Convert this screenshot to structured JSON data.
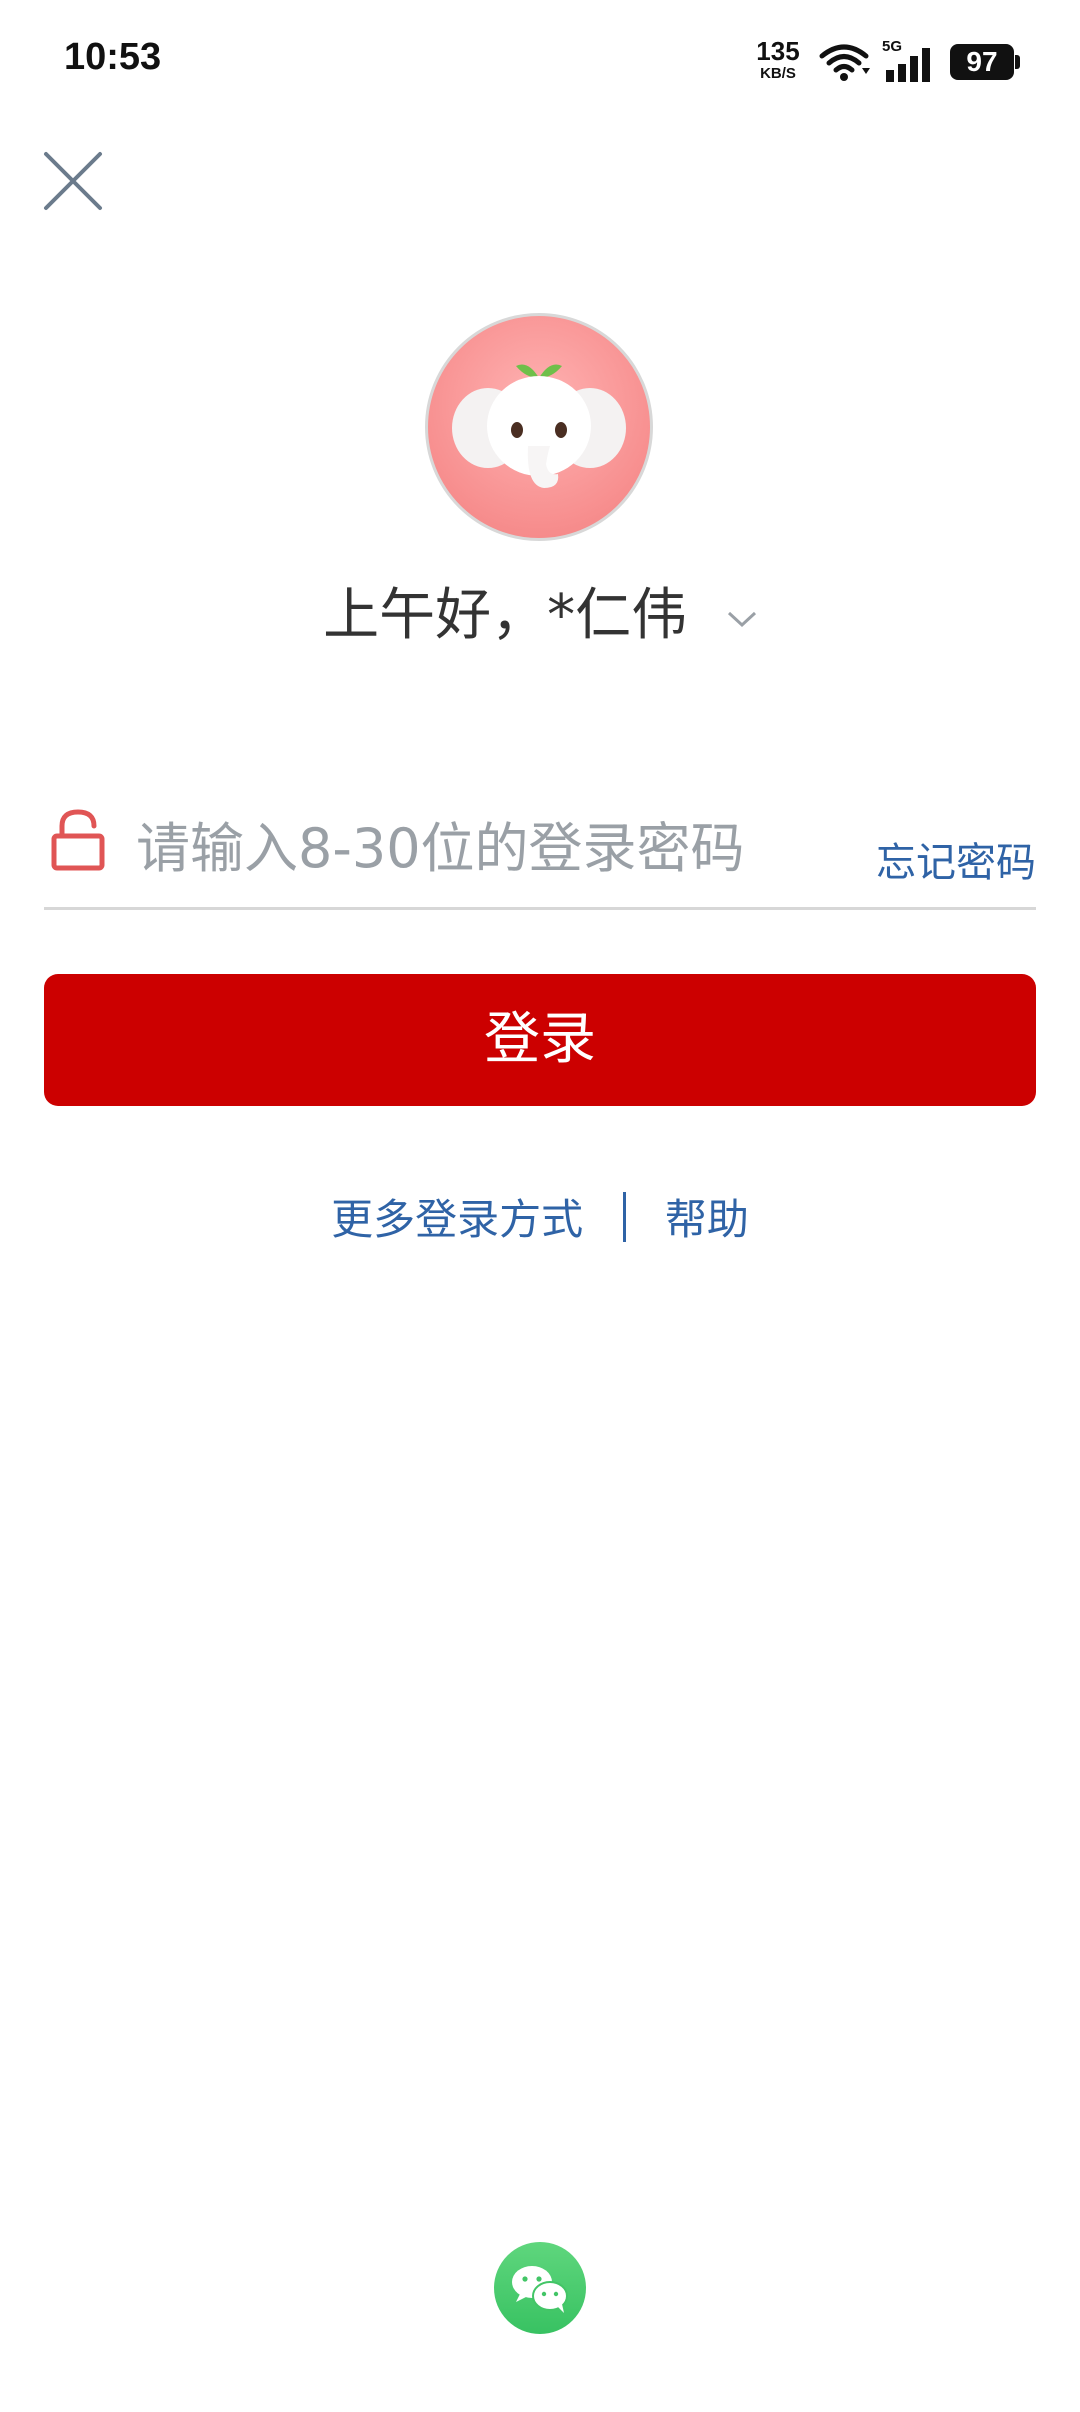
{
  "status_bar": {
    "time": "10:53",
    "net_speed_value": "135",
    "net_speed_unit": "KB/S",
    "network_type": "5G",
    "battery": "97"
  },
  "greeting": {
    "text": "上午好，*仁伟"
  },
  "password": {
    "placeholder": "请输入8-30位的登录密码",
    "forgot_label": "忘记密码"
  },
  "login_button": {
    "label": "登录"
  },
  "links": {
    "more_login": "更多登录方式",
    "help": "帮助"
  },
  "colors": {
    "primary_red": "#cc0000",
    "link_blue": "#2f63a6",
    "wechat_green": "#38c262"
  },
  "icons": {
    "close": "close-icon",
    "lock": "lock-icon",
    "chevron": "chevron-down-icon",
    "wechat": "wechat-icon",
    "avatar": "elephant-mascot"
  }
}
